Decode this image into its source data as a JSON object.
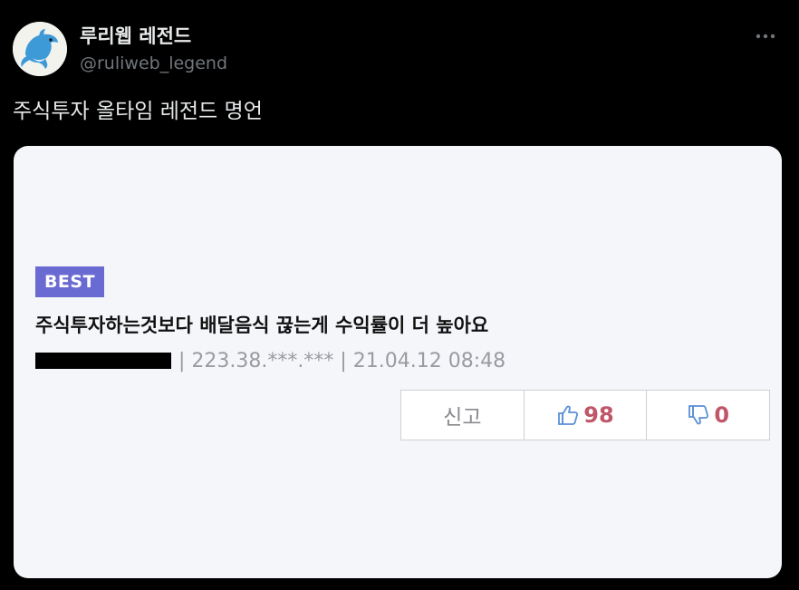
{
  "account": {
    "display_name": "루리웹 레전드",
    "handle": "@ruliweb_legend",
    "avatar_icon": "dolphin-icon",
    "more_icon": "more-horizontal-icon"
  },
  "tweet": {
    "text": "주식투자 올타임 레전드 명언"
  },
  "card": {
    "badge": "BEST",
    "post_title": "주식투자하는것보다 배달음식 끊는게 수익률이 더 높아요",
    "meta": "| 223.38.***.*** | 21.04.12 08:48",
    "report_label": "신고",
    "likes": "98",
    "dislikes": "0",
    "accent_color": "#6a6bd2",
    "count_color": "#c0566a"
  }
}
